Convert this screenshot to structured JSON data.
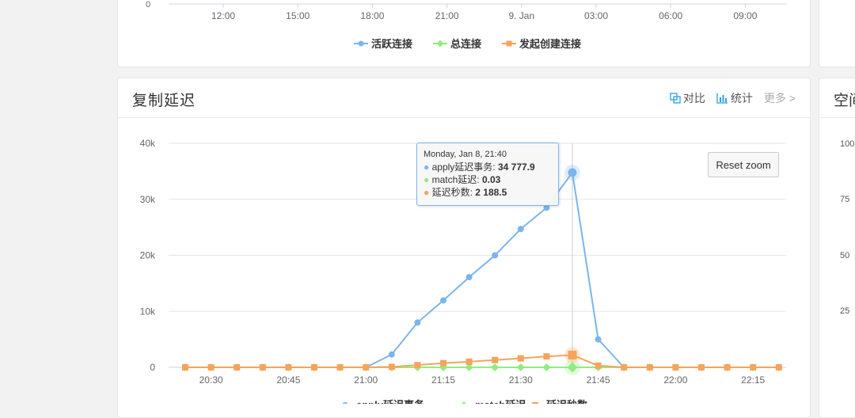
{
  "top_chart": {
    "y_tick": "0",
    "x_ticks": [
      "12:00",
      "15:00",
      "18:00",
      "21:00",
      "9. Jan",
      "03:00",
      "06:00",
      "09:00"
    ],
    "legend": [
      {
        "label": "活跃连接",
        "color": "#7cb5ec",
        "marker": "circle"
      },
      {
        "label": "总连接",
        "color": "#90ed7d",
        "marker": "diamond"
      },
      {
        "label": "发起创建连接",
        "color": "#f7a35c",
        "marker": "square"
      }
    ]
  },
  "main_panel": {
    "title": "复制延迟",
    "actions": {
      "compare": "对比",
      "stats": "统计",
      "more": "更多 >"
    },
    "reset_zoom": "Reset zoom",
    "tooltip": {
      "date": "Monday, Jan 8, 21:40",
      "rows": [
        {
          "label": "apply延迟事务",
          "value": "34 777.9",
          "color": "#7cb5ec"
        },
        {
          "label": "match延迟",
          "value": "0.03",
          "color": "#90ed7d"
        },
        {
          "label": "延迟秒数",
          "value": "2 188.5",
          "color": "#f7a35c"
        }
      ]
    }
  },
  "right_panel": {
    "title": "空间",
    "ticks": [
      "100",
      "75",
      "50",
      "25"
    ]
  },
  "chart_data": {
    "type": "line",
    "title": "复制延迟",
    "x": [
      "20:25",
      "20:30",
      "20:35",
      "20:40",
      "20:45",
      "20:50",
      "20:55",
      "21:00",
      "21:05",
      "21:10",
      "21:15",
      "21:20",
      "21:25",
      "21:30",
      "21:35",
      "21:40",
      "21:45",
      "21:50",
      "21:55",
      "22:00",
      "22:05",
      "22:10",
      "22:15",
      "22:20"
    ],
    "x_ticks": [
      "20:30",
      "20:45",
      "21:00",
      "21:15",
      "21:30",
      "21:45",
      "22:00",
      "22:15"
    ],
    "y_ticks": [
      "0",
      "10k",
      "20k",
      "30k",
      "40k"
    ],
    "ylim": [
      0,
      40000
    ],
    "grid": true,
    "series": [
      {
        "name": "apply延迟事务",
        "color": "#7cb5ec",
        "marker": "circle",
        "values": [
          0,
          0,
          0,
          0,
          0,
          0,
          0,
          0,
          2300,
          8000,
          11950,
          16100,
          20000,
          24700,
          28500,
          34777.9,
          5000,
          0,
          0,
          0,
          0,
          0,
          0,
          0
        ]
      },
      {
        "name": "match延迟",
        "color": "#90ed7d",
        "marker": "diamond",
        "values": [
          0,
          0,
          0,
          0,
          0,
          0,
          0,
          0,
          0,
          0,
          0,
          0,
          0,
          0,
          0,
          0.03,
          0,
          0,
          0,
          0,
          0,
          0,
          0,
          0
        ]
      },
      {
        "name": "延迟秒数",
        "color": "#f7a35c",
        "marker": "square",
        "values": [
          0,
          0,
          0,
          0,
          0,
          0,
          0,
          0,
          80,
          400,
          750,
          1000,
          1300,
          1600,
          1950,
          2188.5,
          300,
          0,
          0,
          0,
          0,
          0,
          0,
          0
        ]
      }
    ],
    "hover_index": 15
  }
}
